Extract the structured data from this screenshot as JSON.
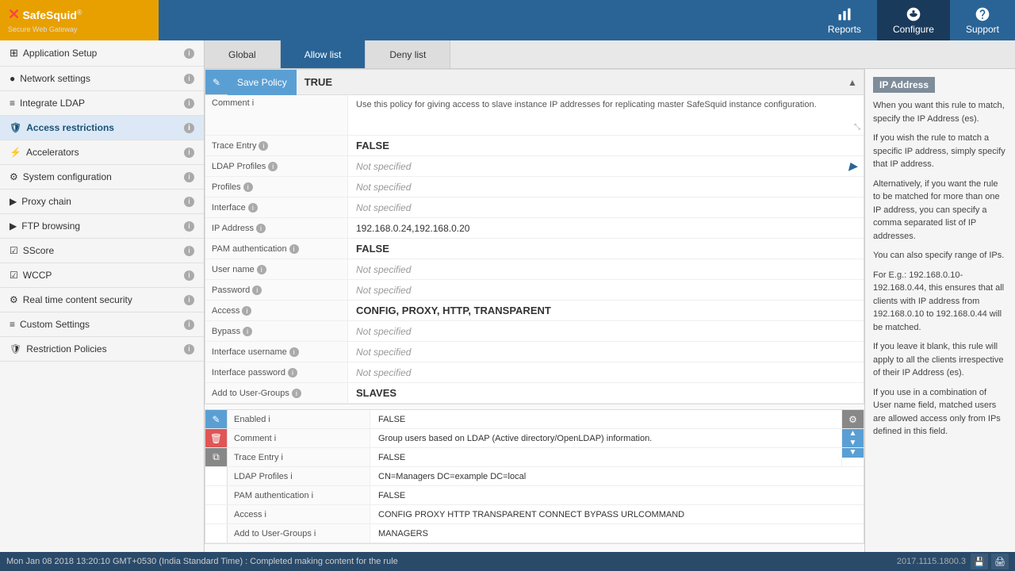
{
  "topnav": {
    "brand": "SafeSquid",
    "trademark": "®",
    "tagline": "Secure Web Gateway",
    "reports_label": "Reports",
    "configure_label": "Configure",
    "support_label": "Support"
  },
  "sidebar": {
    "items": [
      {
        "id": "application-setup",
        "label": "Application Setup",
        "icon": "grid",
        "active": false
      },
      {
        "id": "network-settings",
        "label": "Network settings",
        "icon": "network",
        "active": false
      },
      {
        "id": "integrate-ldap",
        "label": "Integrate LDAP",
        "icon": "ldap",
        "active": false
      },
      {
        "id": "access-restrictions",
        "label": "Access restrictions",
        "icon": "shield",
        "active": true
      },
      {
        "id": "accelerators",
        "label": "Accelerators",
        "icon": "flash",
        "active": false
      },
      {
        "id": "system-configuration",
        "label": "System configuration",
        "icon": "cog",
        "active": false
      },
      {
        "id": "proxy-chain",
        "label": "Proxy chain",
        "icon": "chain",
        "active": false
      },
      {
        "id": "ftp-browsing",
        "label": "FTP browsing",
        "icon": "ftp",
        "active": false
      },
      {
        "id": "sscore",
        "label": "SScore",
        "icon": "score",
        "active": false
      },
      {
        "id": "wccp",
        "label": "WCCP",
        "icon": "wccp",
        "active": false
      },
      {
        "id": "real-time-content-security",
        "label": "Real time content security",
        "icon": "rt",
        "active": false
      },
      {
        "id": "custom-settings",
        "label": "Custom Settings",
        "icon": "custom",
        "active": false
      },
      {
        "id": "restriction-policies",
        "label": "Restriction Policies",
        "icon": "policy",
        "active": false
      }
    ]
  },
  "tabs": {
    "items": [
      {
        "id": "global",
        "label": "Global",
        "active": false
      },
      {
        "id": "allow-list",
        "label": "Allow list",
        "active": true
      },
      {
        "id": "deny-list",
        "label": "Deny list",
        "active": false
      }
    ]
  },
  "policy1": {
    "save_button": "Save Policy",
    "enabled_value": "TRUE",
    "comment_value": "Use this policy for giving access to slave instance IP addresses for replicating master SafeSquid instance configuration.",
    "trace_entry_value": "FALSE",
    "ldap_profiles_placeholder": "Not specified",
    "profiles_placeholder": "Not specified",
    "interface_placeholder": "Not specified",
    "ip_address_value": "192.168.0.24,192.168.0.20",
    "pam_auth_value": "FALSE",
    "user_name_placeholder": "Not specified",
    "password_placeholder": "Not specified",
    "access_value": "CONFIG,  PROXY,  HTTP,  TRANSPARENT",
    "bypass_placeholder": "Not specified",
    "interface_username_placeholder": "Not specified",
    "interface_password_placeholder": "Not specified",
    "add_to_user_groups_value": "SLAVES",
    "labels": {
      "comment": "Comment",
      "trace_entry": "Trace Entry",
      "ldap_profiles": "LDAP Profiles",
      "profiles": "Profiles",
      "interface": "Interface",
      "ip_address": "IP Address",
      "pam_auth": "PAM authentication",
      "user_name": "User name",
      "password": "Password",
      "access": "Access",
      "bypass": "Bypass",
      "interface_username": "Interface username",
      "interface_password": "Interface password",
      "add_to_user_groups": "Add to User-Groups"
    }
  },
  "policy2": {
    "enabled_label": "Enabled",
    "enabled_value": "FALSE",
    "comment_label": "Comment",
    "comment_value": "Group users based on LDAP (Active directory/OpenLDAP) information.",
    "trace_entry_label": "Trace Entry",
    "trace_entry_value": "FALSE",
    "ldap_profiles_label": "LDAP Profiles",
    "ldap_profiles_value": "CN=Managers DC=example DC=local",
    "pam_auth_label": "PAM authentication",
    "pam_auth_value": "FALSE",
    "access_label": "Access",
    "access_value": "CONFIG  PROXY  HTTP  TRANSPARENT  CONNECT  BYPASS  URLCOMMAND",
    "add_to_user_groups_label": "Add to User-Groups",
    "add_to_user_groups_value": "MANAGERS"
  },
  "right_panel": {
    "title": "IP Address",
    "paragraphs": [
      "When you want this rule to match, specify the IP Address (es).",
      "If you wish the rule to match a specific IP address, simply specify that IP address.",
      "Alternatively, if you want the rule to be matched for more than one IP address, you can specify a comma separated list of IP addresses.",
      "You can also specify range of IPs.",
      "For E.g.: 192.168.0.10-192.168.0.44, this ensures that all clients with IP address from 192.168.0.10 to 192.168.0.44 will be matched.",
      "If you leave it blank, this rule will apply to all the clients irrespective of their IP Address (es).",
      "If you use in a combination of User name field, matched users are allowed access only from IPs defined in this field."
    ]
  },
  "statusbar": {
    "message": "Mon Jan 08 2018 13:20:10 GMT+0530 (India Standard Time) : Completed making content for the rule",
    "version": "2017.1115.1800.3"
  }
}
